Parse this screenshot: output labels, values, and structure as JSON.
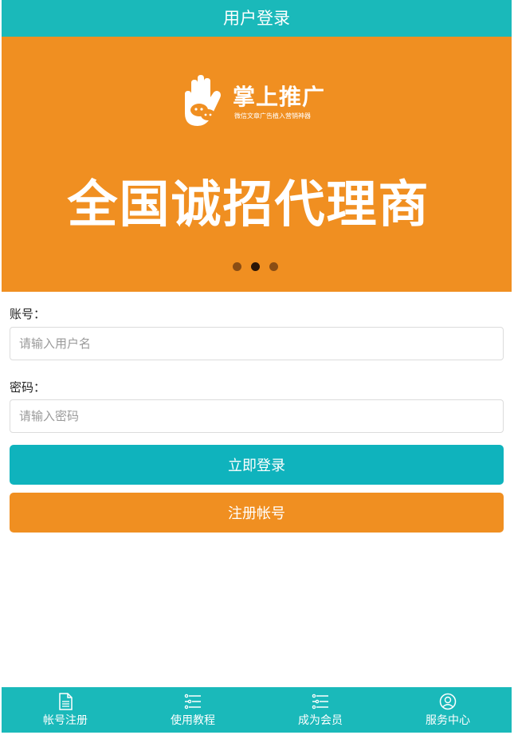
{
  "header": {
    "title": "用户登录"
  },
  "banner": {
    "logo_title": "掌上推广",
    "logo_subtitle": "微信文章广告植入营销神器",
    "slogan": "全国诚招代理商",
    "dots": 3,
    "active_dot": 2
  },
  "form": {
    "account_label": "账号：",
    "account_placeholder": "请输入用户名",
    "password_label": "密码：",
    "password_placeholder": "请输入密码",
    "login_button": "立即登录",
    "register_button": "注册帐号"
  },
  "tabbar": {
    "items": [
      {
        "label": "帐号注册",
        "icon": "document-icon"
      },
      {
        "label": "使用教程",
        "icon": "list-icon"
      },
      {
        "label": "成为会员",
        "icon": "list-icon"
      },
      {
        "label": "服务中心",
        "icon": "user-circle-icon"
      }
    ]
  },
  "colors": {
    "teal": "#1ab9ba",
    "orange": "#f08f21",
    "login_button": "#0fb3bd"
  }
}
